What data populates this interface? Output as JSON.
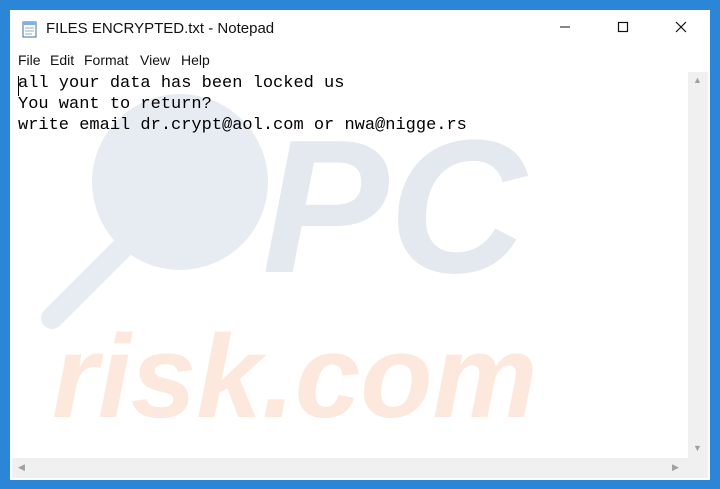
{
  "window": {
    "title": "FILES ENCRYPTED.txt - Notepad",
    "icon": "notepad-icon",
    "controls": {
      "minimize_icon": "minimize-icon",
      "maximize_icon": "maximize-icon",
      "close_icon": "close-icon"
    }
  },
  "menu": {
    "file": "File",
    "edit": "Edit",
    "format": "Format",
    "view": "View",
    "help": "Help"
  },
  "editor": {
    "lines": [
      "all your data has been locked us",
      "You want to return?",
      "write email dr.crypt@aol.com or nwa@nigge.rs"
    ]
  },
  "watermark": {
    "text_top": "PC",
    "text_bottom": "risk.com"
  },
  "colors": {
    "desktop": "#2b86d8",
    "watermark_gray": "#dde3ea",
    "watermark_orange": "#fde7da"
  }
}
